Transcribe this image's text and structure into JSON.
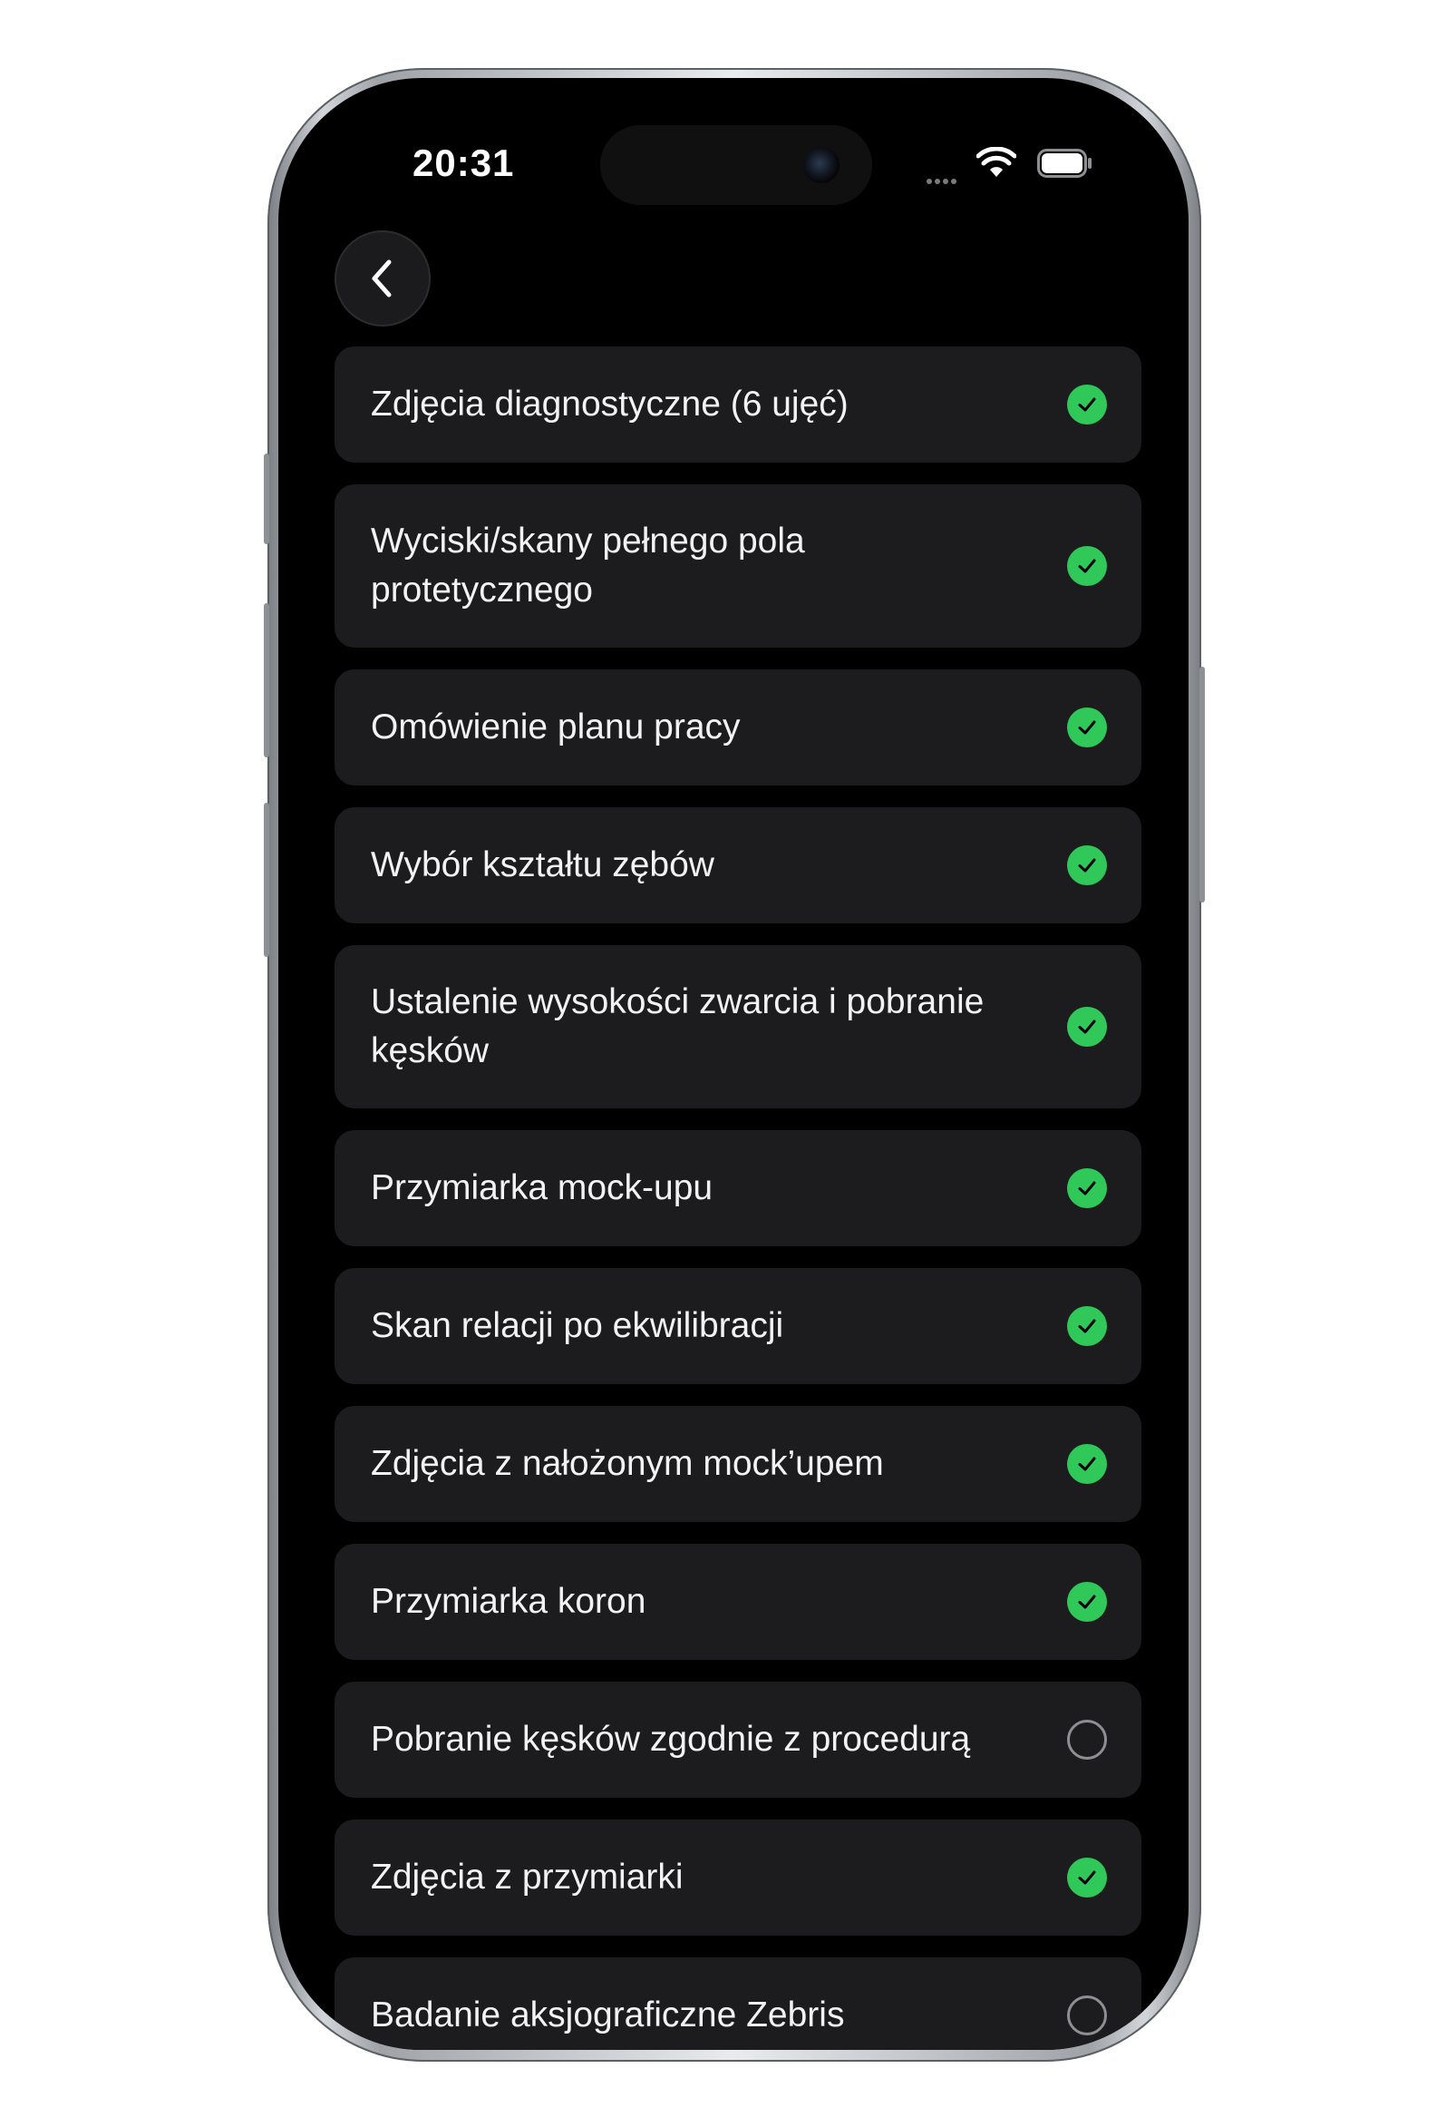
{
  "status_bar": {
    "time": "20:31"
  },
  "navigation": {
    "back_icon": "chevron-left-icon"
  },
  "checklist": [
    {
      "label": "Zdjęcia diagnostyczne (6 ujęć)",
      "completed": true
    },
    {
      "label": "Wyciski/skany pełnego pola protetycznego",
      "completed": true
    },
    {
      "label": "Omówienie planu pracy",
      "completed": true
    },
    {
      "label": "Wybór kształtu zębów",
      "completed": true
    },
    {
      "label": "Ustalenie wysokości zwarcia i pobranie kęsków",
      "completed": true
    },
    {
      "label": "Przymiarka mock-upu",
      "completed": true
    },
    {
      "label": "Skan relacji po ekwilibracji",
      "completed": true
    },
    {
      "label": "Zdjęcia z nałożonym mock’upem",
      "completed": true
    },
    {
      "label": "Przymiarka koron",
      "completed": true
    },
    {
      "label": "Pobranie kęsków zgodnie z procedurą",
      "completed": false
    },
    {
      "label": "Zdjęcia z przymiarki",
      "completed": true
    },
    {
      "label": "Badanie aksjograficzne Zebris",
      "completed": false
    }
  ],
  "colors": {
    "completed": "#31c85a",
    "row_background": "#1c1c1e",
    "screen_background": "#000000"
  }
}
